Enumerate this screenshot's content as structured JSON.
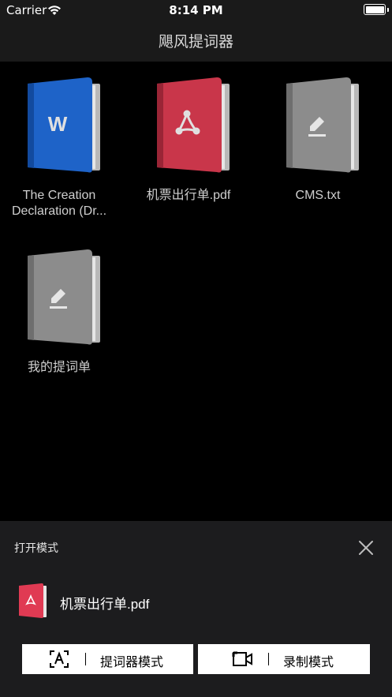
{
  "status_bar": {
    "carrier": "Carrier",
    "time": "8:14 PM"
  },
  "nav": {
    "title": "飓风提词器"
  },
  "files": [
    {
      "name": "The Creation Declaration (Dr...",
      "type": "word",
      "icon": "word-document-icon",
      "color": "#1e63c8"
    },
    {
      "name": "机票出行单.pdf",
      "type": "pdf",
      "icon": "pdf-document-icon",
      "color": "#c9364a"
    },
    {
      "name": "CMS.txt",
      "type": "txt",
      "icon": "text-document-icon",
      "color": "#8c8c8c"
    },
    {
      "name": "我的提词单",
      "type": "txt",
      "icon": "text-document-icon",
      "color": "#8c8c8c"
    }
  ],
  "sheet": {
    "title": "打开模式",
    "file_name": "机票出行单.pdf",
    "buttons": {
      "teleprompter_label": "提词器模式",
      "record_label": "录制模式"
    }
  },
  "colors": {
    "background": "#000000",
    "bar": "#1a1a1a",
    "sheet": "#1c1c1e",
    "word_blue": "#1e63c8",
    "pdf_red": "#c9364a",
    "txt_gray": "#8c8c8c"
  }
}
